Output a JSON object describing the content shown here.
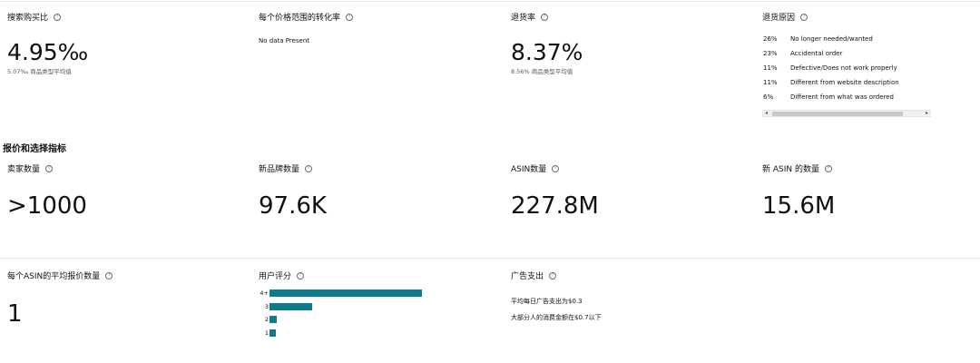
{
  "row1": {
    "search_purchase_ratio": {
      "label": "搜索购买比",
      "value": "4.95‰",
      "subtext": "5.07‰ 商品类型平均值"
    },
    "conversion_by_price": {
      "label": "每个价格范围的转化率",
      "note": "No data Present"
    },
    "return_rate": {
      "label": "退货率",
      "value": "8.37%",
      "subtext": "8.56% 商品类型平均值"
    },
    "return_reasons": {
      "label": "退货原因",
      "items": [
        {
          "pct": "26%",
          "reason": "No longer needed/wanted"
        },
        {
          "pct": "23%",
          "reason": "Accidental order"
        },
        {
          "pct": "11%",
          "reason": "Defective/Does not work properly"
        },
        {
          "pct": "11%",
          "reason": "Different from website description"
        },
        {
          "pct": "6%",
          "reason": "Different from what was ordered"
        }
      ]
    }
  },
  "section": {
    "title": "报价和选择指标"
  },
  "row2": {
    "seller_count": {
      "label": "卖家数量",
      "value": ">1000"
    },
    "new_brand_count": {
      "label": "新品牌数量",
      "value": "97.6K"
    },
    "asin_count": {
      "label": "ASIN数量",
      "value": "227.8M"
    },
    "new_asin_count": {
      "label": "新 ASIN 的数量",
      "value": "15.6M"
    }
  },
  "row3": {
    "avg_offers": {
      "label": "每个ASIN的平均报价数量",
      "value": "1"
    },
    "ratings": {
      "label": "用户评分",
      "bars": [
        {
          "label": "4+",
          "share": 1.0
        },
        {
          "label": "3",
          "share": 0.28
        },
        {
          "label": "2",
          "share": 0.05
        },
        {
          "label": "1",
          "share": 0.04
        }
      ]
    },
    "ad_spend": {
      "label": "广告支出",
      "line1": "平均每日广告支出为$0.3",
      "line2": "大部分人的消费金额在$0.7以下"
    }
  },
  "colors": {
    "bar": "#0e7c8c",
    "divider": "#e3e6e6"
  },
  "icons": {
    "help": "help-circle-icon",
    "scroll_left": "arrow-left-icon",
    "scroll_right": "arrow-right-icon"
  },
  "help_glyph": "?",
  "scroll_left_glyph": "◂",
  "scroll_right_glyph": "▸"
}
